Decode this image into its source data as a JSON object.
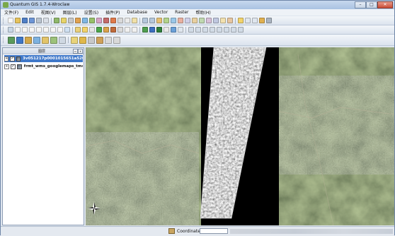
{
  "window": {
    "title": "Quantum GIS 1.7.4-Wroclaw",
    "min": "–",
    "max": "□",
    "close": "✕"
  },
  "menu": [
    {
      "label": "文件(F)"
    },
    {
      "label": "Edit"
    },
    {
      "label": "视图(V)"
    },
    {
      "label": "图层(L)"
    },
    {
      "label": "设置(S)"
    },
    {
      "label": "插件(P)"
    },
    {
      "label": "Database"
    },
    {
      "label": "Vector"
    },
    {
      "label": "Raster"
    },
    {
      "label": "帮助(H)"
    }
  ],
  "layers_panel": {
    "title": "图层",
    "float_button": "▫",
    "close_button": "x",
    "layers": [
      {
        "name": "3v051217p0001015651a5200...",
        "expand": "+",
        "checked": "✓",
        "selected": true
      },
      {
        "name": "frmt_wms_googlemaps_tms",
        "expand": "+",
        "checked": "✓",
        "selected": false
      }
    ]
  },
  "statusbar": {
    "coordinate_label": "Coordinate:"
  },
  "colors": {
    "selection": "#3f78c9",
    "titlebar": "#a9c2e2",
    "imagery_dark": "#111111"
  }
}
